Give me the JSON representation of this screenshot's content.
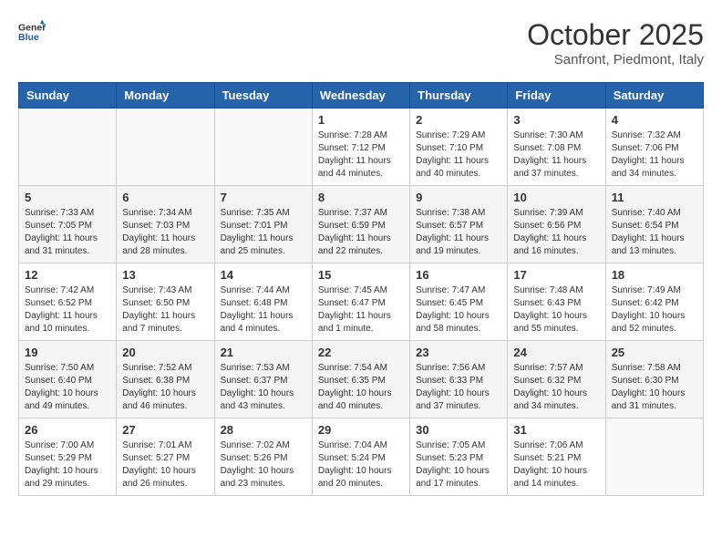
{
  "header": {
    "logo_general": "General",
    "logo_blue": "Blue",
    "month_title": "October 2025",
    "subtitle": "Sanfront, Piedmont, Italy"
  },
  "weekdays": [
    "Sunday",
    "Monday",
    "Tuesday",
    "Wednesday",
    "Thursday",
    "Friday",
    "Saturday"
  ],
  "weeks": [
    [
      {
        "day": "",
        "info": ""
      },
      {
        "day": "",
        "info": ""
      },
      {
        "day": "",
        "info": ""
      },
      {
        "day": "1",
        "info": "Sunrise: 7:28 AM\nSunset: 7:12 PM\nDaylight: 11 hours\nand 44 minutes."
      },
      {
        "day": "2",
        "info": "Sunrise: 7:29 AM\nSunset: 7:10 PM\nDaylight: 11 hours\nand 40 minutes."
      },
      {
        "day": "3",
        "info": "Sunrise: 7:30 AM\nSunset: 7:08 PM\nDaylight: 11 hours\nand 37 minutes."
      },
      {
        "day": "4",
        "info": "Sunrise: 7:32 AM\nSunset: 7:06 PM\nDaylight: 11 hours\nand 34 minutes."
      }
    ],
    [
      {
        "day": "5",
        "info": "Sunrise: 7:33 AM\nSunset: 7:05 PM\nDaylight: 11 hours\nand 31 minutes."
      },
      {
        "day": "6",
        "info": "Sunrise: 7:34 AM\nSunset: 7:03 PM\nDaylight: 11 hours\nand 28 minutes."
      },
      {
        "day": "7",
        "info": "Sunrise: 7:35 AM\nSunset: 7:01 PM\nDaylight: 11 hours\nand 25 minutes."
      },
      {
        "day": "8",
        "info": "Sunrise: 7:37 AM\nSunset: 6:59 PM\nDaylight: 11 hours\nand 22 minutes."
      },
      {
        "day": "9",
        "info": "Sunrise: 7:38 AM\nSunset: 6:57 PM\nDaylight: 11 hours\nand 19 minutes."
      },
      {
        "day": "10",
        "info": "Sunrise: 7:39 AM\nSunset: 6:56 PM\nDaylight: 11 hours\nand 16 minutes."
      },
      {
        "day": "11",
        "info": "Sunrise: 7:40 AM\nSunset: 6:54 PM\nDaylight: 11 hours\nand 13 minutes."
      }
    ],
    [
      {
        "day": "12",
        "info": "Sunrise: 7:42 AM\nSunset: 6:52 PM\nDaylight: 11 hours\nand 10 minutes."
      },
      {
        "day": "13",
        "info": "Sunrise: 7:43 AM\nSunset: 6:50 PM\nDaylight: 11 hours\nand 7 minutes."
      },
      {
        "day": "14",
        "info": "Sunrise: 7:44 AM\nSunset: 6:48 PM\nDaylight: 11 hours\nand 4 minutes."
      },
      {
        "day": "15",
        "info": "Sunrise: 7:45 AM\nSunset: 6:47 PM\nDaylight: 11 hours\nand 1 minute."
      },
      {
        "day": "16",
        "info": "Sunrise: 7:47 AM\nSunset: 6:45 PM\nDaylight: 10 hours\nand 58 minutes."
      },
      {
        "day": "17",
        "info": "Sunrise: 7:48 AM\nSunset: 6:43 PM\nDaylight: 10 hours\nand 55 minutes."
      },
      {
        "day": "18",
        "info": "Sunrise: 7:49 AM\nSunset: 6:42 PM\nDaylight: 10 hours\nand 52 minutes."
      }
    ],
    [
      {
        "day": "19",
        "info": "Sunrise: 7:50 AM\nSunset: 6:40 PM\nDaylight: 10 hours\nand 49 minutes."
      },
      {
        "day": "20",
        "info": "Sunrise: 7:52 AM\nSunset: 6:38 PM\nDaylight: 10 hours\nand 46 minutes."
      },
      {
        "day": "21",
        "info": "Sunrise: 7:53 AM\nSunset: 6:37 PM\nDaylight: 10 hours\nand 43 minutes."
      },
      {
        "day": "22",
        "info": "Sunrise: 7:54 AM\nSunset: 6:35 PM\nDaylight: 10 hours\nand 40 minutes."
      },
      {
        "day": "23",
        "info": "Sunrise: 7:56 AM\nSunset: 6:33 PM\nDaylight: 10 hours\nand 37 minutes."
      },
      {
        "day": "24",
        "info": "Sunrise: 7:57 AM\nSunset: 6:32 PM\nDaylight: 10 hours\nand 34 minutes."
      },
      {
        "day": "25",
        "info": "Sunrise: 7:58 AM\nSunset: 6:30 PM\nDaylight: 10 hours\nand 31 minutes."
      }
    ],
    [
      {
        "day": "26",
        "info": "Sunrise: 7:00 AM\nSunset: 5:29 PM\nDaylight: 10 hours\nand 29 minutes."
      },
      {
        "day": "27",
        "info": "Sunrise: 7:01 AM\nSunset: 5:27 PM\nDaylight: 10 hours\nand 26 minutes."
      },
      {
        "day": "28",
        "info": "Sunrise: 7:02 AM\nSunset: 5:26 PM\nDaylight: 10 hours\nand 23 minutes."
      },
      {
        "day": "29",
        "info": "Sunrise: 7:04 AM\nSunset: 5:24 PM\nDaylight: 10 hours\nand 20 minutes."
      },
      {
        "day": "30",
        "info": "Sunrise: 7:05 AM\nSunset: 5:23 PM\nDaylight: 10 hours\nand 17 minutes."
      },
      {
        "day": "31",
        "info": "Sunrise: 7:06 AM\nSunset: 5:21 PM\nDaylight: 10 hours\nand 14 minutes."
      },
      {
        "day": "",
        "info": ""
      }
    ]
  ]
}
